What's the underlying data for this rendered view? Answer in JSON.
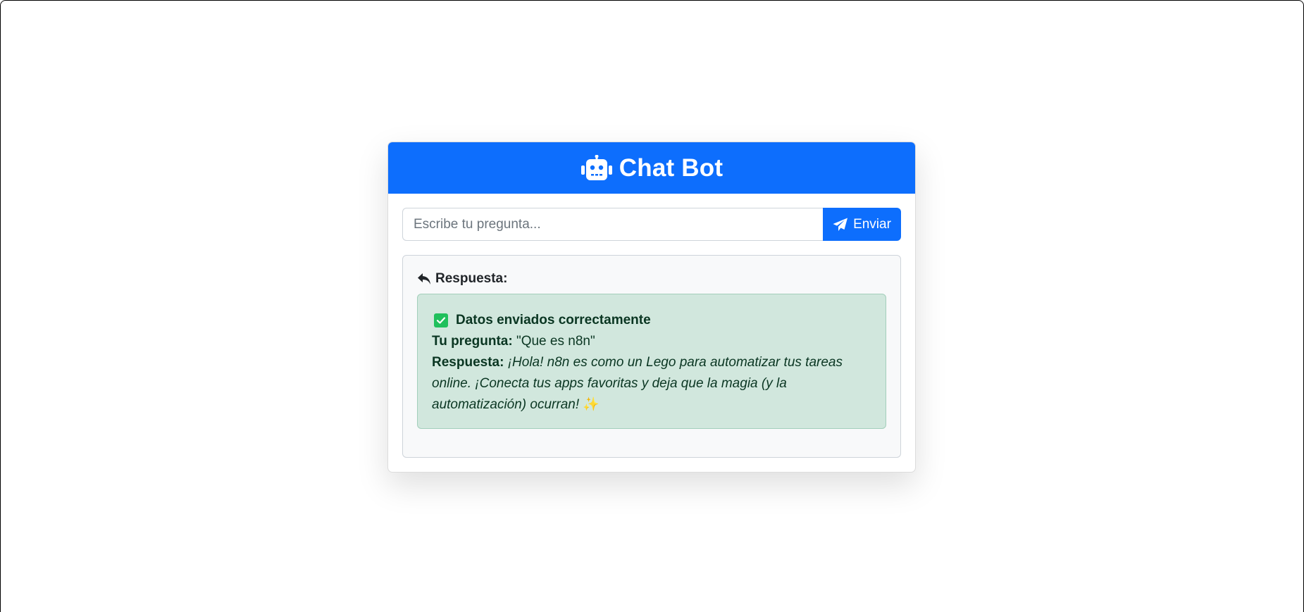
{
  "header": {
    "title": "Chat Bot",
    "icon": "robot-icon"
  },
  "form": {
    "input_placeholder": "Escribe tu pregunta...",
    "input_value": "",
    "send_label": "Enviar",
    "send_icon": "paper-plane-icon"
  },
  "response": {
    "heading": "Respuesta:",
    "heading_icon": "reply-icon",
    "alert_title": "Datos enviados correctamente",
    "alert_icon": "check-square-icon",
    "question_label": "Tu pregunta:",
    "question_text": "\"Que es n8n\"",
    "answer_label": "Respuesta:",
    "answer_text": "¡Hola! n8n es como un Lego para automatizar tus tareas online. ¡Conecta tus apps favoritas y deja que la magia (y la automatización) ocurran!",
    "answer_emoji": "✨"
  },
  "colors": {
    "primary": "#0d6efd",
    "success_bg": "#d1e7dd",
    "success_text": "#0a3622",
    "check_green": "#20c05c"
  }
}
